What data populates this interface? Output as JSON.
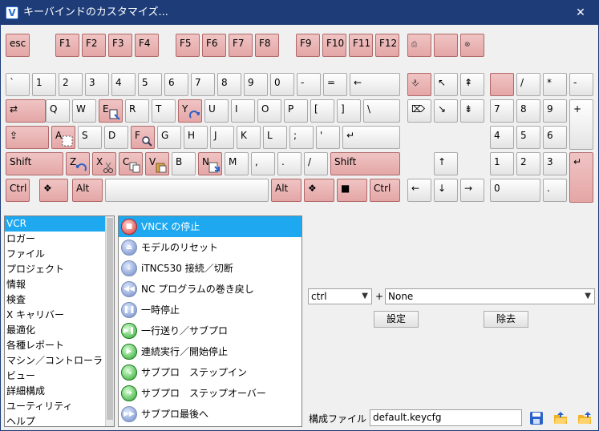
{
  "window": {
    "title": "キーバインドのカスタマイズ...",
    "close_label": "✕"
  },
  "keys": {
    "esc": "esc",
    "f1": "F1",
    "f2": "F2",
    "f3": "F3",
    "f4": "F4",
    "f5": "F5",
    "f6": "F6",
    "f7": "F7",
    "f8": "F8",
    "f9": "F9",
    "f10": "F10",
    "f11": "F11",
    "f12": "F12",
    "backquote": "`",
    "d1": "1",
    "d2": "2",
    "d3": "3",
    "d4": "4",
    "d5": "5",
    "d6": "6",
    "d7": "7",
    "d8": "8",
    "d9": "9",
    "d0": "0",
    "minus": "-",
    "equal": "=",
    "backspace": "←",
    "tab": "⇄",
    "q": "Q",
    "w": "W",
    "e": "E",
    "r": "R",
    "t": "T",
    "y": "Y",
    "u": "U",
    "i": "I",
    "o": "O",
    "p": "P",
    "lbracket": "[",
    "rbracket": "]",
    "backslash": "\\",
    "caps": "⇪",
    "a": "A",
    "s": "S",
    "d": "D",
    "f": "F",
    "g": "G",
    "h": "H",
    "j": "J",
    "k": "K",
    "l": "L",
    "semicolon": ";",
    "quote": "'",
    "enter": "↵",
    "lshift": "Shift",
    "z": "Z",
    "x": "X",
    "c": "C",
    "v": "V",
    "b": "B",
    "n": "N",
    "m": "M",
    "comma": ",",
    "period": ".",
    "slash": "/",
    "rshift": "Shift",
    "lctrl": "Ctrl",
    "lwin": "❖",
    "lalt": "Alt",
    "space": "",
    "ralt": "Alt",
    "rwin": "❖",
    "menu": "■",
    "rctrl": "Ctrl",
    "ins": "⎀",
    "home": "↖",
    "pgup": "⇞",
    "del": "⌦",
    "end": "↘",
    "pgdn": "⇟",
    "up": "↑",
    "left": "←",
    "down": "↓",
    "right": "→",
    "numlock": "",
    "ndiv": "/",
    "nmul": "*",
    "nsub": "-",
    "n7": "7",
    "n8": "8",
    "n9": "9",
    "nadd": "+",
    "n4": "4",
    "n5": "5",
    "n6": "6",
    "n1": "1",
    "n2": "2",
    "n3": "3",
    "nenter": "↵",
    "n0": "0",
    "ndot": "."
  },
  "categories": [
    "VCR",
    "ロガー",
    "ファイル",
    "プロジェクト",
    "情報",
    "検査",
    "X キャリバー",
    "最適化",
    "各種レポート",
    "マシン／コントローラ",
    "ビュー",
    "詳細構成",
    "ユーティリティ",
    "ヘルプ"
  ],
  "selected_category": "VCR",
  "commands": [
    {
      "label": "VNCK の停止",
      "icon": "stop-icon",
      "sel": true
    },
    {
      "label": "モデルのリセット",
      "icon": "eject-icon",
      "sel": false
    },
    {
      "label": "iTNC530 接続／切断",
      "icon": "plug-icon",
      "sel": false
    },
    {
      "label": "NC プログラムの巻き戻し",
      "icon": "rewind-icon",
      "sel": false
    },
    {
      "label": "一時停止",
      "icon": "pause-icon",
      "sel": false
    },
    {
      "label": "一行送り／サブプロ",
      "icon": "step-icon",
      "sel": false
    },
    {
      "label": "連続実行／開始停止",
      "icon": "play-icon",
      "sel": false
    },
    {
      "label": "サブプロ　ステップイン",
      "icon": "step-in-icon",
      "sel": false
    },
    {
      "label": "サブプロ　ステップオーバー",
      "icon": "step-over-icon",
      "sel": false
    },
    {
      "label": "サブプロ最後へ",
      "icon": "fast-forward-icon",
      "sel": false
    }
  ],
  "modifier": {
    "value": "ctrl",
    "plus": "+"
  },
  "key_select": {
    "value": "None"
  },
  "buttons": {
    "set": "設定",
    "remove": "除去"
  },
  "config": {
    "label": "構成ファイル",
    "value": "default.keycfg"
  },
  "colors": {
    "titlebar": "#1d3c78",
    "selection": "#1ea8f0",
    "bound_key": "#e4a6a6"
  }
}
